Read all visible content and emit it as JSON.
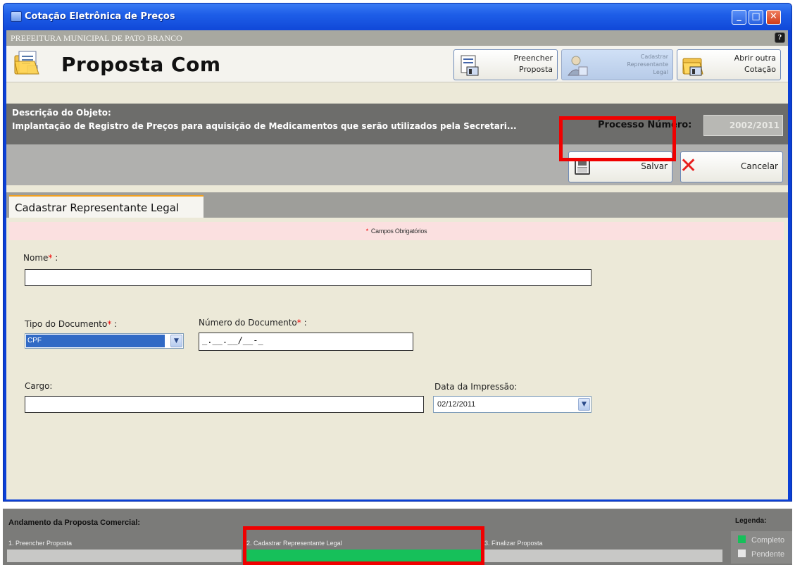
{
  "window": {
    "title": "Cotação Eletrônica de Preços",
    "min_glyph": "_",
    "max_glyph": "□",
    "close_glyph": "✕"
  },
  "org_bar": {
    "text": "PREFEITURA MUNICIPAL DE PATO BRANCO",
    "help_glyph": "?"
  },
  "header": {
    "page_title": "Proposta Com",
    "buttons": [
      {
        "line1": "Preencher",
        "line2": "Proposta"
      },
      {
        "line1": "Cadastrar",
        "line2": "Representante",
        "line3": "Legal"
      },
      {
        "line1": "Abrir outra",
        "line2": "Cotação"
      }
    ]
  },
  "description": {
    "label": "Descrição do Objeto:",
    "value": "Implantação de Registro de Preços para aquisição de Medicamentos que serão utilizados pela Secretari...",
    "process_label": "Processo Número:",
    "process_value": "2002/2011"
  },
  "actions": {
    "save_label": "Salvar",
    "cancel_label": "Cancelar",
    "cancel_glyph": "✕"
  },
  "tab": {
    "label": "Cadastrar Representante Legal"
  },
  "form": {
    "required_note": "Campos Obrigatórios",
    "star": "*",
    "nome_label": "Nome",
    "nome_value": "",
    "tipo_label": "Tipo do Documento",
    "tipo_value": "CPF",
    "numero_label": "Número do Documento",
    "numero_value": "_.__.__/__-_",
    "cargo_label": "Cargo:",
    "cargo_value": "",
    "data_label": "Data da Impressão:",
    "data_value": "02/12/2011",
    "colon": " :"
  },
  "progress": {
    "title": "Andamento da Proposta Comercial:",
    "steps": [
      {
        "label": "1. Preencher Proposta",
        "status": "pendente"
      },
      {
        "label": "2. Cadastrar Representante Legal",
        "status": "completo"
      },
      {
        "label": "3. Finalizar Proposta",
        "status": "pendente"
      }
    ],
    "legend_title": "Legenda:",
    "legend": [
      {
        "label": "Completo",
        "color": "#16c05a"
      },
      {
        "label": "Pendente",
        "color": "#e6e6e6"
      }
    ]
  },
  "colors": {
    "titlebar": "#1e5ee8",
    "highlight": "#f00000",
    "complete": "#16c05a",
    "pending": "#c8c8c6"
  },
  "icons": [
    "app-icon",
    "folder-document-icon",
    "form-icon",
    "representative-icon",
    "folder-open-icon",
    "save-icon",
    "cancel-icon",
    "help-icon"
  ]
}
